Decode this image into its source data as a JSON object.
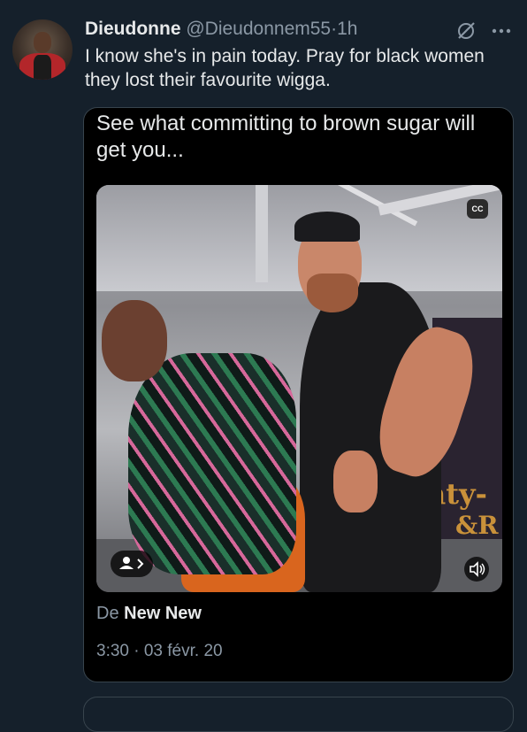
{
  "tweet": {
    "author_name": "Dieudonne",
    "handle": "@Dieudonnem55",
    "separator": "·",
    "time": "1h",
    "text": "I know she's in pain today. Pray for black women they lost their favourite wigga."
  },
  "quote": {
    "text": "See what committing to brown sugar will get you...",
    "video": {
      "sign_text": "hty-",
      "sign_text2": "&R",
      "cc_label": "CC"
    },
    "source_prefix": "De",
    "source_name": "New New",
    "timestamp": "3:30 · 03 févr. 20"
  },
  "icons": [
    "grok-icon",
    "more-icon",
    "cc-icon",
    "profile-icon",
    "chevron-right-icon",
    "volume-icon"
  ],
  "colors": {
    "background": "#15202b",
    "quote_background": "#000000",
    "border": "#38444d",
    "secondary_text": "#8b98a5",
    "primary_text": "#e7e9ea"
  }
}
